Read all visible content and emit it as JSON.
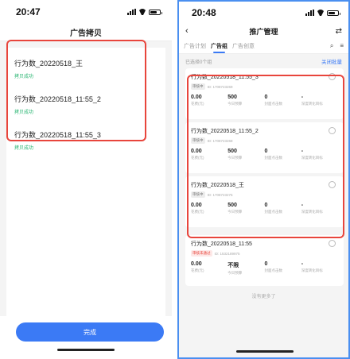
{
  "left": {
    "time": "20:47",
    "title": "广告拷贝",
    "items": [
      {
        "name": "行为数_20220518_王",
        "status": "拷贝成功"
      },
      {
        "name": "行为数_20220518_11:55_2",
        "status": "拷贝成功"
      },
      {
        "name": "行为数_20220518_11:55_3",
        "status": "拷贝成功"
      }
    ],
    "done_label": "完成"
  },
  "right": {
    "time": "20:48",
    "title": "推广管理",
    "back_icon": "back-arrow-icon",
    "swap_icon": "swap-icon",
    "tabs": [
      {
        "label": "广告计划",
        "active": false
      },
      {
        "label": "广告组",
        "active": true
      },
      {
        "label": "广告创意",
        "active": false
      }
    ],
    "selected_text": "已选择0个组",
    "close_batch": "关闭批量",
    "groups": [
      {
        "name": "行为数_20220518_11:55_3",
        "badge": "审核中",
        "id": "ID: 1708723269",
        "stats": [
          {
            "v": "0.00",
            "l": "花费(元)"
          },
          {
            "v": "500",
            "l": "今日预算"
          },
          {
            "v": "0",
            "l": "封面点击数"
          },
          {
            "v": "-",
            "l": "深度转化目标"
          }
        ]
      },
      {
        "name": "行为数_20220518_11:55_2",
        "badge": "审核中",
        "id": "ID: 1708723268",
        "stats": [
          {
            "v": "0.00",
            "l": "花费(元)"
          },
          {
            "v": "500",
            "l": "今日预算"
          },
          {
            "v": "0",
            "l": "封面点击数"
          },
          {
            "v": "-",
            "l": "深度转化目标"
          }
        ]
      },
      {
        "name": "行为数_20220518_王",
        "badge": "审核中",
        "id": "ID: 1708723276",
        "stats": [
          {
            "v": "0.00",
            "l": "花费(元)"
          },
          {
            "v": "500",
            "l": "今日预算"
          },
          {
            "v": "0",
            "l": "封面点击数"
          },
          {
            "v": "-",
            "l": "深度转化目标"
          }
        ]
      },
      {
        "name": "行为数_20220518_11:55",
        "badge": "审核未通过",
        "id": "ID: 1532189975",
        "stats": [
          {
            "v": "0.00",
            "l": "花费(元)"
          },
          {
            "v": "不限",
            "l": "今日预算"
          },
          {
            "v": "0",
            "l": "封面点击数"
          },
          {
            "v": "-",
            "l": "深度转化目标"
          }
        ]
      }
    ],
    "no_more": "没有更多了"
  },
  "colors": {
    "accent": "#3b7af5",
    "highlight": "#e8453c",
    "success": "#2bb673"
  }
}
